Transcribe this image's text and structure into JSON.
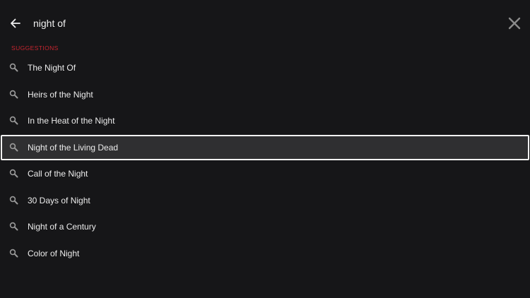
{
  "search": {
    "query": "night of"
  },
  "icons": {
    "back": "back-arrow-icon",
    "close": "close-icon",
    "suggestion": "search-icon"
  },
  "colors": {
    "background": "#161618",
    "accent": "#c8252f",
    "text": "#ececec",
    "selected_background": "#2f2f31",
    "selected_border": "#f2f2f2"
  },
  "suggestions_section": {
    "title": "SUGGESTIONS",
    "selected_index": 3,
    "items": [
      {
        "label": "The Night Of"
      },
      {
        "label": "Heirs of the Night"
      },
      {
        "label": "In the Heat of the Night"
      },
      {
        "label": "Night of the Living Dead"
      },
      {
        "label": "Call of the Night"
      },
      {
        "label": "30 Days of Night"
      },
      {
        "label": "Night of a Century"
      },
      {
        "label": "Color of Night"
      }
    ]
  }
}
